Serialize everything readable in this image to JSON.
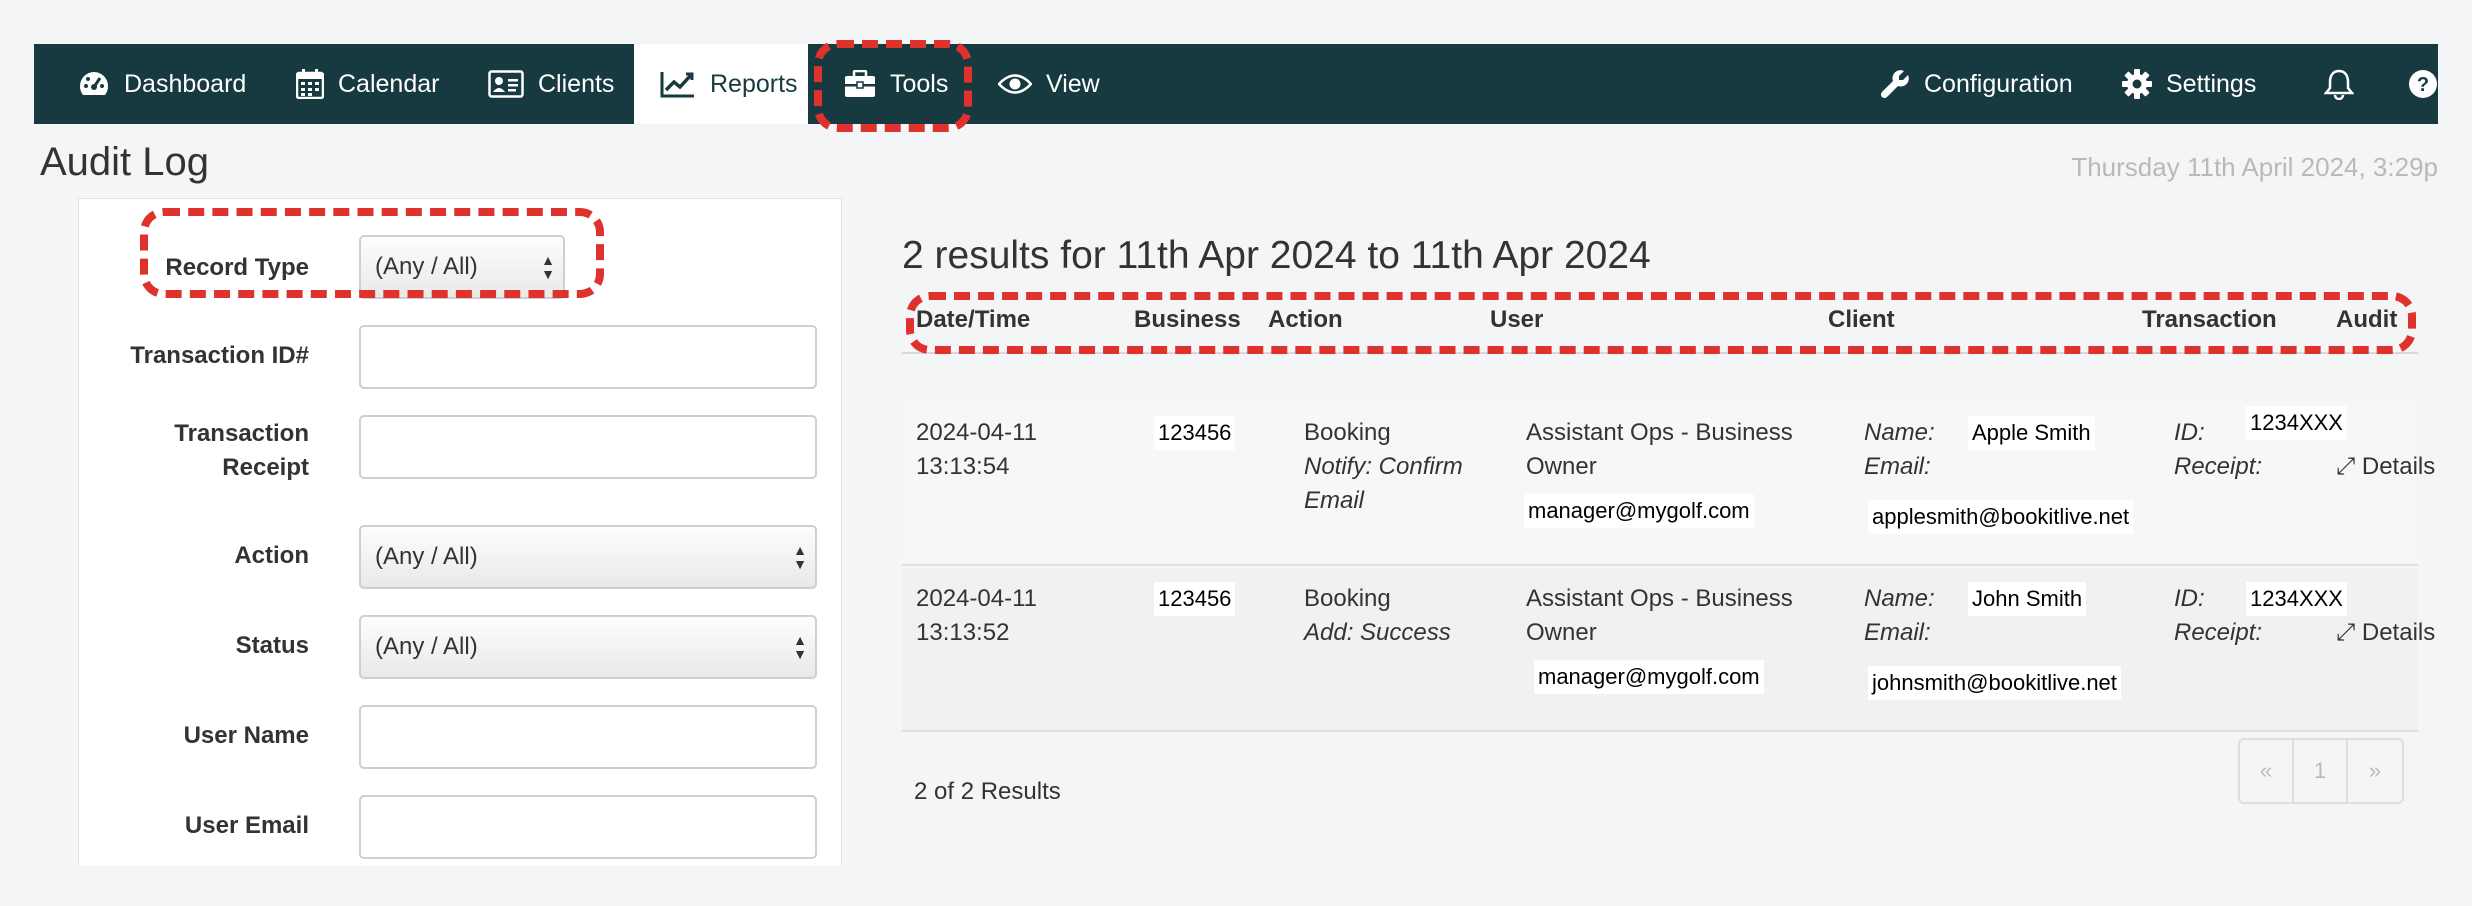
{
  "nav": {
    "left": [
      {
        "label": "Dashboard",
        "icon": "dashboard-gauge-icon"
      },
      {
        "label": "Calendar",
        "icon": "calendar-icon"
      },
      {
        "label": "Clients",
        "icon": "id-card-icon"
      },
      {
        "label": "Reports",
        "icon": "line-chart-icon",
        "active": true
      },
      {
        "label": "Tools",
        "icon": "briefcase-icon"
      },
      {
        "label": "View",
        "icon": "eye-icon"
      }
    ],
    "right": [
      {
        "label": "Configuration",
        "icon": "wrench-icon"
      },
      {
        "label": "Settings",
        "icon": "gear-icon"
      },
      {
        "label": "",
        "icon": "bell-icon"
      },
      {
        "label": "",
        "icon": "help-icon"
      }
    ]
  },
  "page": {
    "title": "Audit Log",
    "date": "Thursday 11th April 2024, 3:29p"
  },
  "filters": {
    "record_type": {
      "label": "Record Type",
      "value": "(Any / All)"
    },
    "transaction_id": {
      "label": "Transaction ID#",
      "value": ""
    },
    "transaction_receipt": {
      "label_line1": "Transaction",
      "label_line2": "Receipt",
      "value": ""
    },
    "action": {
      "label": "Action",
      "value": "(Any / All)"
    },
    "status": {
      "label": "Status",
      "value": "(Any / All)"
    },
    "user_name": {
      "label": "User Name",
      "value": ""
    },
    "user_email": {
      "label": "User Email",
      "value": ""
    }
  },
  "results": {
    "heading": "2 results for 11th Apr 2024 to 11th Apr 2024",
    "columns": [
      "Date/Time",
      "Business",
      "Action",
      "User",
      "Client",
      "Transaction",
      "Audit"
    ],
    "name_label": "Name:",
    "email_label": "Email:",
    "id_label": "ID:",
    "receipt_label": "Receipt:",
    "details_label": "Details",
    "rows": [
      {
        "date": "2024-04-11",
        "time": "13:13:54",
        "business": "123456",
        "action": "Booking",
        "action_detail_1": "Notify: Confirm",
        "action_detail_2": "Email",
        "user_line1": "Assistant Ops - Business",
        "user_line2": "Owner",
        "user_email": "manager@mygolf.com",
        "client_name": "Apple Smith",
        "client_email": "applesmith@bookitlive.net",
        "transaction_id": "1234XXX"
      },
      {
        "date": "2024-04-11",
        "time": "13:13:52",
        "business": "123456",
        "action": "Booking",
        "action_detail_1": "Add: Success",
        "action_detail_2": "",
        "user_line1": "Assistant Ops - Business",
        "user_line2": "Owner",
        "user_email": "manager@mygolf.com",
        "client_name": "John Smith",
        "client_email": "johnsmith@bookitlive.net",
        "transaction_id": "1234XXX"
      }
    ],
    "count_text": "2 of 2 Results"
  },
  "pagination": {
    "prev": "«",
    "page": "1",
    "next": "»"
  },
  "colors": {
    "nav_bg": "#163a40",
    "annotation": "#e0322d"
  }
}
